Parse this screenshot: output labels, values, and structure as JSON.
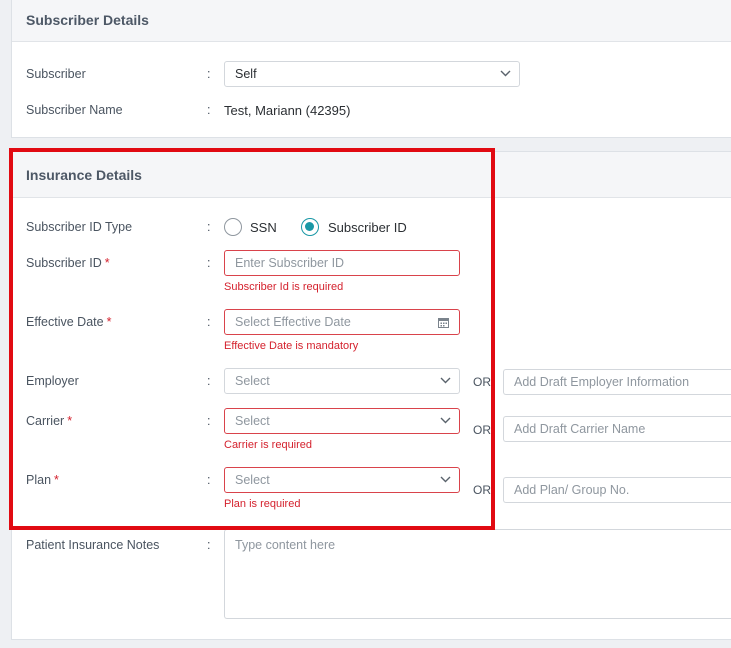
{
  "subscriber_details": {
    "title": "Subscriber Details",
    "subscriber_label": "Subscriber",
    "subscriber_value": "Self",
    "subscriber_name_label": "Subscriber Name",
    "subscriber_name_value": "Test, Mariann (42395)",
    "colon": ":"
  },
  "insurance_details": {
    "title": "Insurance Details",
    "subscriber_id_type": {
      "label": "Subscriber ID Type",
      "options": [
        "SSN",
        "Subscriber ID"
      ],
      "selected": "Subscriber ID"
    },
    "subscriber_id": {
      "label": "Subscriber ID",
      "required_mark": "*",
      "placeholder": "Enter Subscriber ID",
      "error": "Subscriber Id is required"
    },
    "effective_date": {
      "label": "Effective Date",
      "required_mark": "*",
      "placeholder": "Select Effective Date",
      "error": "Effective Date is mandatory"
    },
    "employer": {
      "label": "Employer",
      "placeholder": "Select",
      "or": "OR",
      "alt_placeholder": "Add Draft Employer Information"
    },
    "carrier": {
      "label": "Carrier",
      "required_mark": "*",
      "placeholder": "Select",
      "error": "Carrier is required",
      "or": "OR",
      "alt_placeholder": "Add Draft Carrier Name"
    },
    "plan": {
      "label": "Plan",
      "required_mark": "*",
      "placeholder": "Select",
      "error": "Plan is required",
      "or": "OR",
      "alt_placeholder": "Add Plan/ Group No."
    },
    "notes": {
      "label": "Patient Insurance Notes",
      "placeholder": "Type content here"
    }
  },
  "colors": {
    "accent": "#1a98a6",
    "error": "#d4212d",
    "highlight": "#e10a12"
  }
}
